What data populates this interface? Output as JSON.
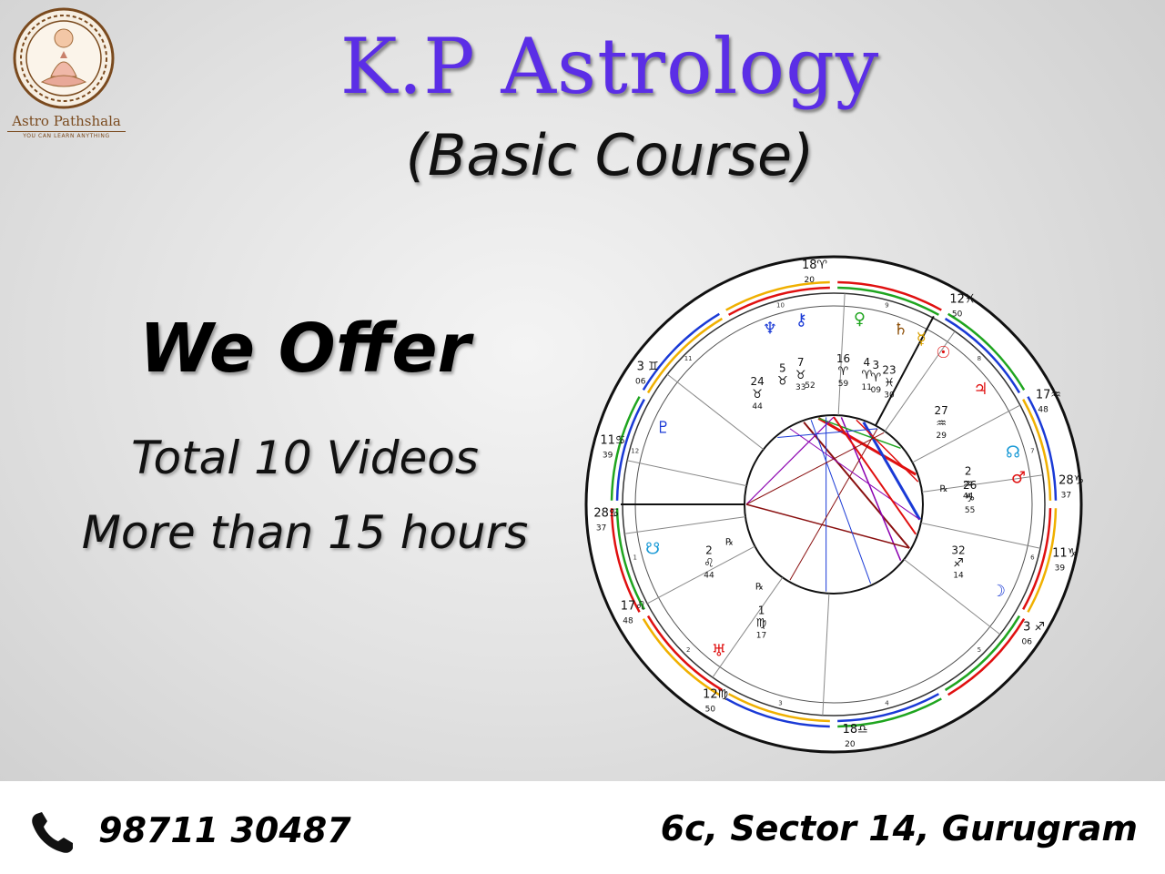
{
  "brand": {
    "name": "Astro Pathshala",
    "tagline": "YOU CAN LEARN ANYTHING"
  },
  "heading": {
    "title": "K.P Astrology",
    "subtitle": "(Basic Course)"
  },
  "offer": {
    "heading": "We Offer",
    "line1": "Total 10 Videos",
    "line2": "More than 15 hours"
  },
  "contact": {
    "phone": "98711 30487",
    "address": "6c, Sector 14, Gurugram"
  },
  "chart_wheel": {
    "outer_labels": [
      {
        "deg": "18",
        "sign": "♈",
        "min": "20"
      },
      {
        "deg": "12",
        "sign": "♓",
        "min": "50"
      },
      {
        "deg": "17",
        "sign": "♒",
        "min": "48"
      },
      {
        "deg": "28",
        "sign": "♑",
        "min": "37"
      },
      {
        "deg": "11",
        "sign": "♑",
        "min": "39"
      },
      {
        "deg": "3",
        "sign": "♐",
        "min": "06"
      },
      {
        "deg": "18",
        "sign": "♎",
        "min": "20"
      },
      {
        "deg": "12",
        "sign": "♍",
        "min": "50"
      },
      {
        "deg": "17",
        "sign": "♌",
        "min": "48"
      },
      {
        "deg": "28",
        "sign": "♋",
        "min": "37"
      },
      {
        "deg": "11",
        "sign": "♋",
        "min": "39"
      },
      {
        "deg": "3",
        "sign": "♊",
        "min": "06"
      }
    ],
    "planets": [
      {
        "glyph": "♆",
        "color": "#1a3ad6"
      },
      {
        "glyph": "⚷",
        "color": "#1a3ad6"
      },
      {
        "glyph": "♀",
        "color": "#1fa51f"
      },
      {
        "glyph": "♄",
        "color": "#8a4a00"
      },
      {
        "glyph": "☿",
        "color": "#d8a000"
      },
      {
        "glyph": "☉",
        "color": "#e01010"
      },
      {
        "glyph": "♃",
        "color": "#e01010"
      },
      {
        "glyph": "☊",
        "color": "#1a9ad6"
      },
      {
        "glyph": "♂",
        "color": "#e01010"
      },
      {
        "glyph": "☽",
        "color": "#1a3ad6"
      },
      {
        "glyph": "♅",
        "color": "#e01010"
      },
      {
        "glyph": "☋",
        "color": "#1a9ad6"
      },
      {
        "glyph": "♇",
        "color": "#1a3ad6"
      }
    ],
    "positions": [
      {
        "deg": "5",
        "sign": "♉",
        "min": ""
      },
      {
        "deg": "7",
        "sign": "♉",
        "min": "33"
      },
      {
        "deg": "",
        "sign": "",
        "min": "52"
      },
      {
        "deg": "16",
        "sign": "♈",
        "min": "59"
      },
      {
        "deg": "4",
        "sign": "♈",
        "min": "11"
      },
      {
        "deg": "3",
        "sign": "♈",
        "min": "09"
      },
      {
        "deg": "23",
        "sign": "♓",
        "min": "30"
      },
      {
        "deg": "24",
        "sign": "♉",
        "min": "44"
      },
      {
        "deg": "27",
        "sign": "♒",
        "min": "29"
      },
      {
        "deg": "2",
        "sign": "♒",
        "min": "44"
      },
      {
        "deg": "26",
        "sign": "♑",
        "min": "55"
      },
      {
        "deg": "32",
        "sign": "♐",
        "min": "14"
      },
      {
        "deg": "2",
        "sign": "♌",
        "min": "44"
      },
      {
        "deg": "1",
        "sign": "♍",
        "min": "17"
      }
    ],
    "house_numbers": [
      "1",
      "2",
      "3",
      "4",
      "5",
      "6",
      "7",
      "8",
      "9",
      "10",
      "11",
      "12"
    ],
    "retrograde_mark": "℞",
    "ring_colors": [
      "#e01010",
      "#1fa51f",
      "#1a3ad6",
      "#f0b000"
    ]
  },
  "colors": {
    "title": "#5b2ee6",
    "brand": "#7a4a1e"
  }
}
